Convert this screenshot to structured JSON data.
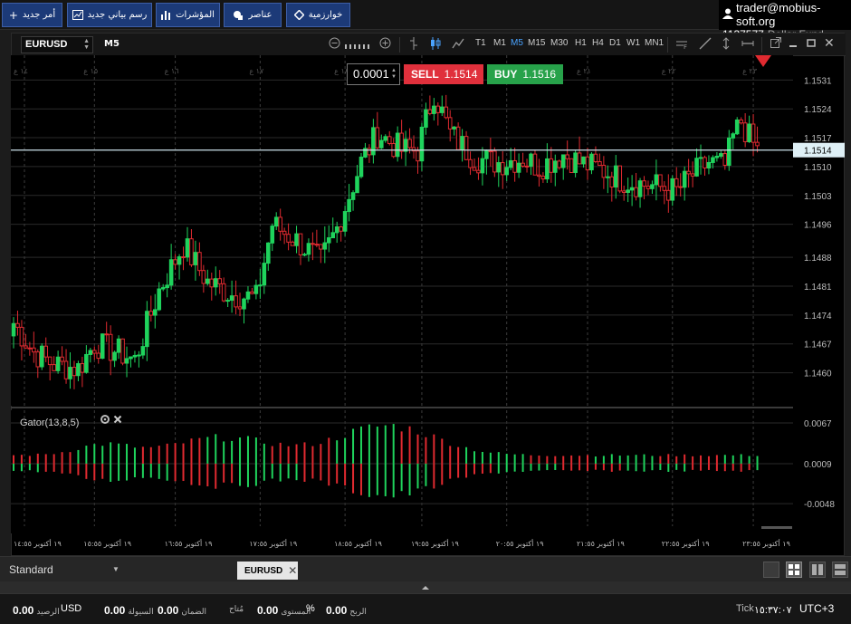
{
  "toolbar": {
    "new_order": "أمر جديد",
    "new_chart": "رسم بياني جديد",
    "indicators": "المؤشرات",
    "objects": "عناصر",
    "algorithms": "خوارزمية"
  },
  "account": {
    "email": "trader@mobius-soft.org",
    "number": "1137577",
    "fund": "Dollar Fund"
  },
  "chart_toolbar": {
    "symbol": "EURUSD",
    "timeframe": "M5",
    "timeframes": [
      "T1",
      "M1",
      "M5",
      "M15",
      "M30",
      "H1",
      "H4",
      "D1",
      "W1",
      "MN1"
    ],
    "active_timeframe": "M5"
  },
  "trade": {
    "lot": "0.0001",
    "sell_label": "SELL",
    "sell_price": "1.1514",
    "buy_label": "BUY",
    "buy_price": "1.1516"
  },
  "colors": {
    "bull": "#1fd35c",
    "bear": "#e02a30",
    "sell": "#e0303c",
    "buy": "#27a24a",
    "grid": "#2a2a2a",
    "price_line": "#cde3ec",
    "accent": "#4aa3ff"
  },
  "chart_data": {
    "type": "candlestick",
    "symbol": "EURUSD",
    "timeframe": "M5",
    "current_price": "1.1514",
    "ylim": [
      1.1452,
      1.1537
    ],
    "y_ticks": [
      "1.1531",
      "1.1524",
      "1.1517",
      "1.1510",
      "1.1503",
      "1.1496",
      "1.1488",
      "1.1481",
      "1.1474",
      "1.1467",
      "1.1460"
    ],
    "x_ticks": [
      "١٩ أكتوبر ١٤:٥٥",
      "١٩ أكتوبر ١٥:٥٥",
      "١٩ أكتوبر ١٦:٥٥",
      "١٩ أكتوبر ١٧:٥٥",
      "١٩ أكتوبر ١٨:٥٥",
      "١٩ أكتوبر ١٩:٥٥",
      "١٩ أكتوبر ٢٠:٥٥",
      "١٩ أكتوبر ٢١:٥٥",
      "١٩ أكتوبر ٢٢:٥٥",
      "١٩ أكتوبر ٢٣:٥٥"
    ],
    "session_labels": [
      "١٤ ع",
      "١٥ ع",
      "١٦ ع",
      "١٧ ع",
      "١٨ ع",
      "١٩ ع",
      "٢٠ ع",
      "٢١ ع",
      "٢٢ ع",
      "٢٣ ع"
    ],
    "close_anchors": [
      [
        0,
        1.1472
      ],
      [
        5,
        1.1465
      ],
      [
        10,
        1.1462
      ],
      [
        16,
        1.1461
      ],
      [
        20,
        1.1467
      ],
      [
        26,
        1.1465
      ],
      [
        30,
        1.1463
      ],
      [
        36,
        1.148
      ],
      [
        42,
        1.1491
      ],
      [
        48,
        1.1482
      ],
      [
        54,
        1.1479
      ],
      [
        60,
        1.1478
      ],
      [
        64,
        1.1496
      ],
      [
        70,
        1.1492
      ],
      [
        76,
        1.1487
      ],
      [
        80,
        1.1495
      ],
      [
        86,
        1.1511
      ],
      [
        90,
        1.1518
      ],
      [
        96,
        1.1514
      ],
      [
        100,
        1.1514
      ],
      [
        104,
        1.1528
      ],
      [
        108,
        1.1518
      ],
      [
        114,
        1.1512
      ],
      [
        120,
        1.1511
      ],
      [
        126,
        1.1512
      ],
      [
        130,
        1.151
      ],
      [
        136,
        1.1513
      ],
      [
        140,
        1.1511
      ],
      [
        146,
        1.1509
      ],
      [
        150,
        1.1507
      ],
      [
        154,
        1.1506
      ],
      [
        160,
        1.1505
      ],
      [
        164,
        1.1504
      ],
      [
        168,
        1.1508
      ],
      [
        172,
        1.1511
      ],
      [
        176,
        1.151
      ],
      [
        178,
        1.1517
      ],
      [
        180,
        1.1521
      ],
      [
        182,
        1.1517
      ],
      [
        184,
        1.1514
      ]
    ],
    "indicator": {
      "name": "Gator(13,8,5)",
      "y_ticks": [
        "0.0067",
        "0.0009",
        "-0.0048"
      ],
      "ylim": [
        -0.008,
        0.0085
      ]
    }
  },
  "bottombar": {
    "profile": "Standard",
    "tab": "EURUSD"
  },
  "status": {
    "balance_value": "0.00",
    "balance_label": "الرصيد",
    "currency": "USD",
    "equity_value": "0.00",
    "equity_label": "السيولة",
    "margin_value": "0.00",
    "margin_label": "الضمان",
    "free_margin_label": "مُتاح",
    "level_value": "0.00",
    "level_label": "المستوى",
    "percent": "%",
    "profit_value": "0.00",
    "profit_label": "الربح",
    "tick_label": "Tick",
    "clock": "١٥:٣٧:٠٧",
    "timezone": "UTC+3"
  }
}
